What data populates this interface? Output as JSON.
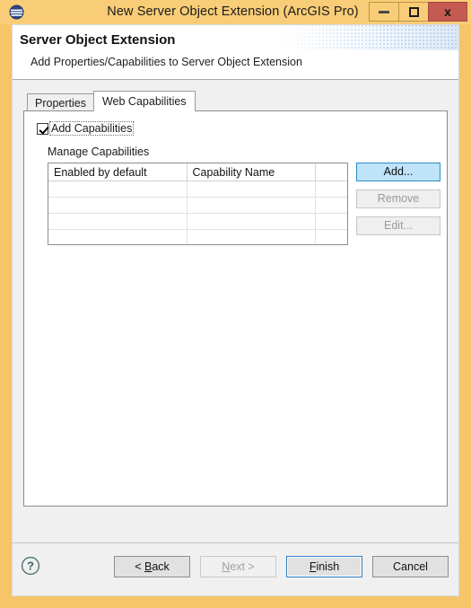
{
  "window": {
    "title": "New Server Object Extension (ArcGIS Pro)",
    "icon": "eclipse-circle-icon",
    "accent_frame_color": "#f6c567",
    "titlebar_color": "#f9cd77",
    "close_button_color": "#c45a51",
    "controls": {
      "minimize": "–",
      "maximize": "□",
      "close": "x"
    }
  },
  "banner": {
    "title": "Server Object Extension",
    "subtitle": "Add Properties/Capabilities to Server Object Extension"
  },
  "tabs": [
    {
      "label": "Properties",
      "selected": false
    },
    {
      "label": "Web Capabilities",
      "selected": true
    }
  ],
  "panel": {
    "add_capabilities": {
      "label": "Add Capabilities",
      "checked": true,
      "focused": true
    },
    "group_label": "Manage Capabilities",
    "table": {
      "columns": [
        "Enabled by default",
        "Capability Name",
        ""
      ],
      "rows": [
        [
          "",
          "",
          ""
        ],
        [
          "",
          "",
          ""
        ],
        [
          "",
          "",
          ""
        ],
        [
          "",
          "",
          ""
        ]
      ]
    },
    "side_buttons": [
      {
        "label": "Add...",
        "state": "hover"
      },
      {
        "label": "Remove",
        "state": "disabled"
      },
      {
        "label": "Edit...",
        "state": "disabled"
      }
    ]
  },
  "footer": {
    "help_icon": "question-mark-icon",
    "buttons": [
      {
        "label": "< Back",
        "mnemonic": "B",
        "state": "normal"
      },
      {
        "label": "Next >",
        "mnemonic": "N",
        "state": "disabled"
      },
      {
        "label": "Finish",
        "mnemonic": "F",
        "state": "default"
      },
      {
        "label": "Cancel",
        "mnemonic": "",
        "state": "normal"
      }
    ]
  },
  "colors": {
    "accent": "#f6c567",
    "focus_blue": "#2f7dc0",
    "hover_blue": "#bfe3f8",
    "close_red": "#c45a51"
  }
}
